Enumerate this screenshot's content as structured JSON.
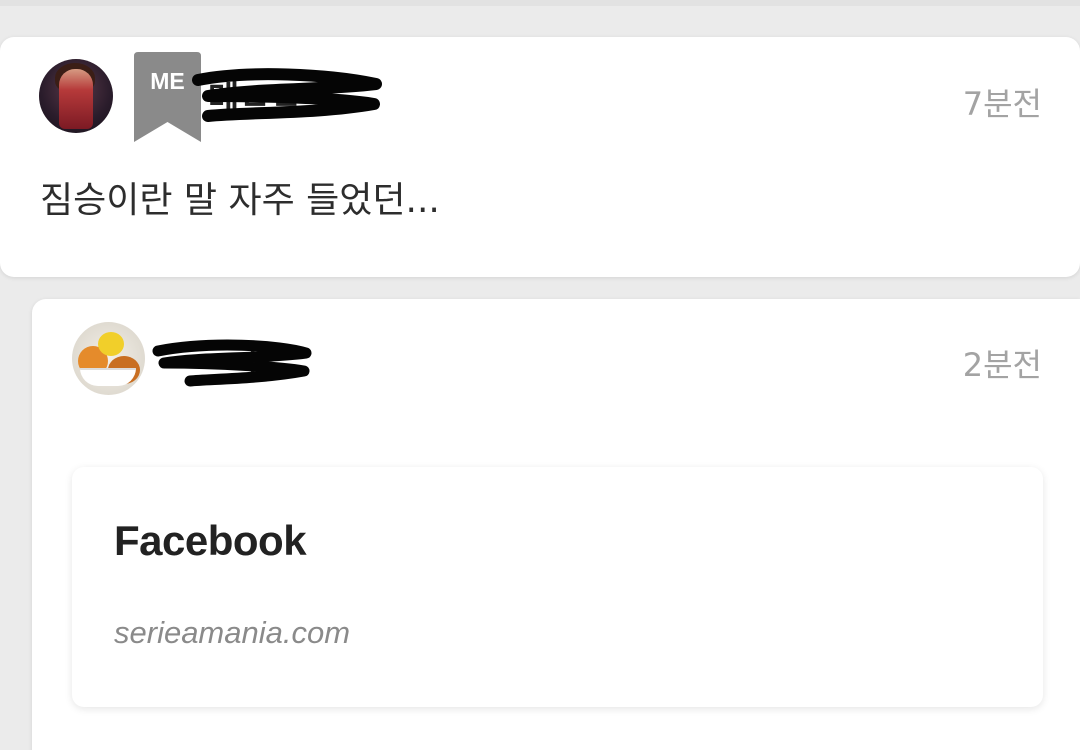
{
  "post": {
    "badge": "ME",
    "username": "메ㅁㅁ",
    "time": "7분전",
    "text": "짐승이란 말 자주 들었던..."
  },
  "reply": {
    "username": "ㅡㅡㅏ",
    "time": "2분전",
    "link_preview": {
      "title": "Facebook",
      "domain": "serieamania.com"
    }
  },
  "colors": {
    "badge_gray": "#8a8a8a",
    "time_gray": "#a3a3a3",
    "card_bg": "#ffffff",
    "page_bg": "#ebebeb"
  }
}
